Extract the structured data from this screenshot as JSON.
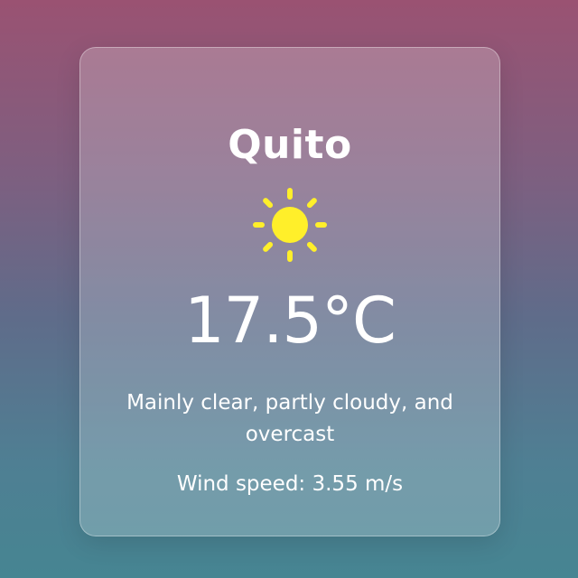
{
  "weather": {
    "city": "Quito",
    "icon": "sun-icon",
    "icon_color": "#ffef2a",
    "temperature": "17.5°C",
    "description": "Mainly clear, partly cloudy, and overcast",
    "wind": "Wind speed: 3.55 m/s"
  }
}
